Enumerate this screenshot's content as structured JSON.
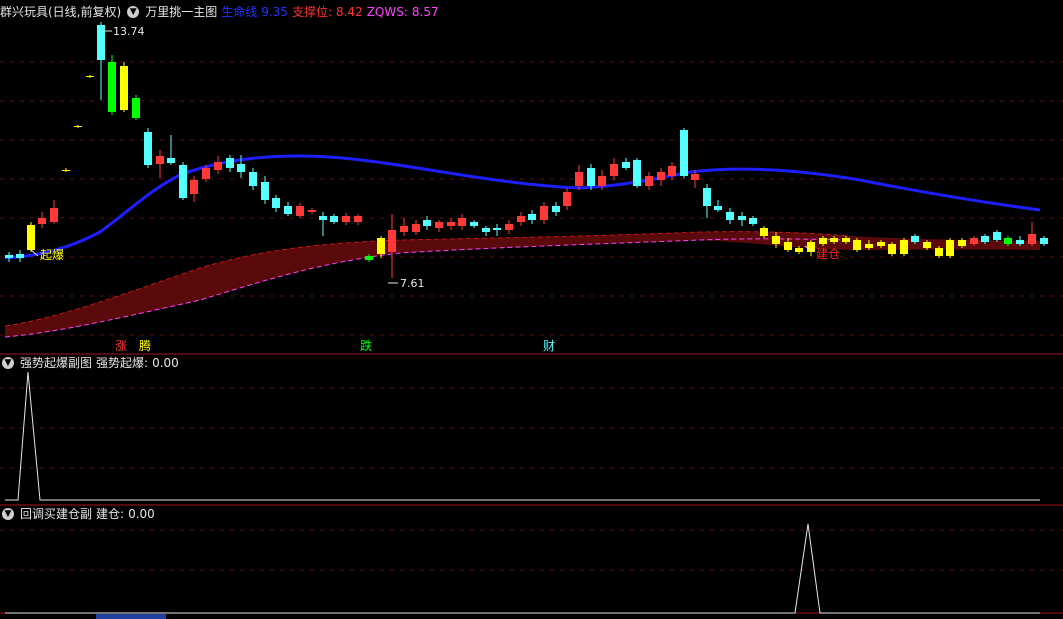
{
  "main_header": {
    "stock_title": "群兴玩具(日线,前复权)",
    "indicator_name": "万里挑一主图",
    "line1_label": "生命线",
    "line1_value": "9.35",
    "support_label": "支撑位:",
    "support_value": "8.42",
    "zqws_label": "ZQWS:",
    "zqws_value": "8.57"
  },
  "sub1_header": {
    "indicator_name": "强势起爆副图",
    "value_label": "强势起爆:",
    "value": "0.00"
  },
  "sub2_header": {
    "indicator_name": "回调买建仓副",
    "value_label": "建仓:",
    "value": "0.00"
  },
  "annotations": {
    "high_price": "13.74",
    "low_price": "7.61",
    "signal_qibao": "起爆",
    "signal_jiancang": "建仓",
    "tag_zhang": "涨",
    "tag_teng": "腾",
    "tag_die": "跌",
    "tag_cai": "财"
  },
  "colors": {
    "up": "#ff3838",
    "down": "#54ffff",
    "blue_line": "#1e1eff",
    "magenta": "#ff40ff",
    "yellow": "#ffff00",
    "green": "#00ff00",
    "panel_border": "#a01818"
  },
  "chart_data": {
    "type": "candlestick",
    "price_axis": [
      7.4,
      14.0
    ],
    "series": [
      {
        "name": "生命线",
        "values_note": "blue moving line",
        "last": 9.35
      },
      {
        "name": "ZQWS",
        "last": 8.57
      },
      {
        "name": "支撑位",
        "last": 8.42
      }
    ],
    "sub_indicators": [
      {
        "name": "强势起爆",
        "value": 0.0
      },
      {
        "name": "建仓",
        "value": 0.0
      }
    ]
  }
}
